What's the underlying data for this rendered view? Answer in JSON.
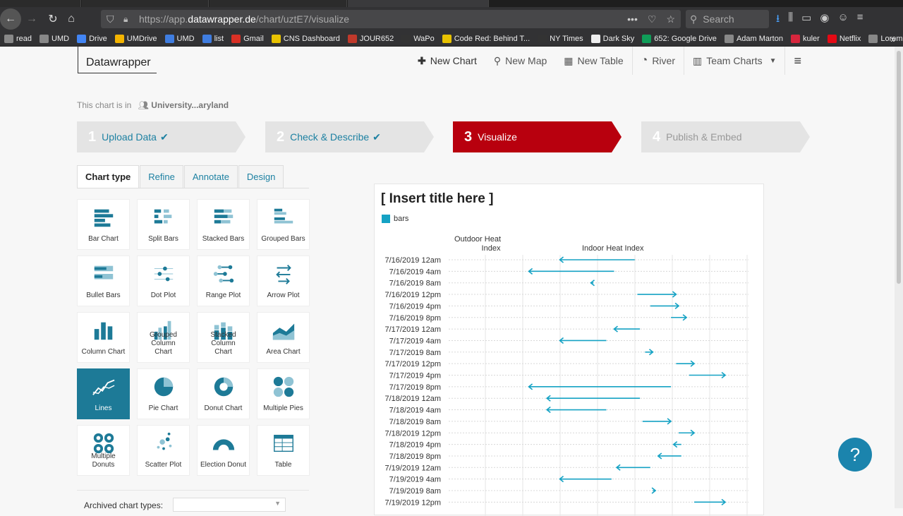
{
  "browser": {
    "url_prefix": "https://app.",
    "url_domain": "datawrapper.de",
    "url_path": "/chart/uztE7/visualize",
    "search_placeholder": "Search",
    "bookmarks": [
      {
        "label": "read",
        "color": "#888"
      },
      {
        "label": "UMD",
        "color": "#888"
      },
      {
        "label": "Drive",
        "color": "#4285f4"
      },
      {
        "label": "UMDrive",
        "color": "#f4b400"
      },
      {
        "label": "UMD",
        "color": "#3f7de0"
      },
      {
        "label": "list",
        "color": "#3f7de0"
      },
      {
        "label": "Gmail",
        "color": "#d93025"
      },
      {
        "label": "CNS Dashboard",
        "color": "#e8c200"
      },
      {
        "label": "JOUR652",
        "color": "#c0392b"
      },
      {
        "label": "WaPo",
        "color": "#333"
      },
      {
        "label": "Code Red: Behind T...",
        "color": "#e8c200"
      },
      {
        "label": "NY Times",
        "color": "#333"
      },
      {
        "label": "Dark Sky",
        "color": "#eee"
      },
      {
        "label": "652: Google Drive",
        "color": "#0f9d58"
      },
      {
        "label": "Adam Marton",
        "color": "#888"
      },
      {
        "label": "kuler",
        "color": "#d7263d"
      },
      {
        "label": "Netflix",
        "color": "#e50914"
      },
      {
        "label": "Lorem",
        "color": "#888"
      }
    ]
  },
  "app": {
    "brand": "Datawrapper",
    "nav": {
      "new_chart": "New Chart",
      "new_map": "New Map",
      "new_table": "New Table",
      "river": "River",
      "team_charts": "Team Charts"
    },
    "breadcrumb_prefix": "This chart is in",
    "breadcrumb_team": "University...aryland",
    "steps": [
      {
        "num": "1",
        "label": "Upload Data",
        "check": "✔"
      },
      {
        "num": "2",
        "label": "Check & Describe",
        "check": "✔"
      },
      {
        "num": "3",
        "label": "Visualize",
        "check": ""
      },
      {
        "num": "4",
        "label": "Publish & Embed",
        "check": ""
      }
    ],
    "tabs": [
      "Chart type",
      "Refine",
      "Annotate",
      "Design"
    ],
    "chart_types": [
      "Bar Chart",
      "Split Bars",
      "Stacked Bars",
      "Grouped Bars",
      "Bullet Bars",
      "Dot Plot",
      "Range Plot",
      "Arrow Plot",
      "Column Chart",
      "Grouped Column Chart",
      "Stacked Column Chart",
      "Area Chart",
      "Lines",
      "Pie Chart",
      "Donut Chart",
      "Multiple Pies",
      "Multiple Donuts",
      "Scatter Plot",
      "Election Donut",
      "Table"
    ],
    "selected_type": "Lines",
    "archived_label": "Archived chart types:",
    "help": "?"
  },
  "chart_data": {
    "type": "arrow",
    "title": "[ Insert title here ]",
    "legend": [
      "bars"
    ],
    "column_labels": [
      "Outdoor Heat Index",
      "Indoor Heat Index"
    ],
    "categories": [
      "7/16/2019 12am",
      "7/16/2019 4am",
      "7/16/2019 8am",
      "7/16/2019 12pm",
      "7/16/2019 4pm",
      "7/16/2019 8pm",
      "7/17/2019 12am",
      "7/17/2019 4am",
      "7/17/2019 8am",
      "7/17/2019 12pm",
      "7/17/2019 4pm",
      "7/17/2019 8pm",
      "7/18/2019 12am",
      "7/18/2019 4am",
      "7/18/2019 8am",
      "7/18/2019 12pm",
      "7/18/2019 4pm",
      "7/18/2019 8pm",
      "7/19/2019 12am",
      "7/19/2019 4am",
      "7/19/2019 8am",
      "7/19/2019 12pm"
    ],
    "from": [
      0.72,
      0.64,
      0.56,
      0.73,
      0.78,
      0.86,
      0.74,
      0.61,
      0.76,
      0.88,
      0.93,
      0.86,
      0.74,
      0.61,
      0.75,
      0.89,
      0.9,
      0.9,
      0.78,
      0.63,
      0.79,
      0.95
    ],
    "to": [
      0.43,
      0.31,
      0.55,
      0.88,
      0.89,
      0.92,
      0.64,
      0.43,
      0.79,
      0.95,
      1.07,
      0.31,
      0.38,
      0.38,
      0.86,
      0.95,
      0.87,
      0.81,
      0.65,
      0.43,
      0.8,
      1.07
    ],
    "color": "#15a2c4",
    "grid": true
  },
  "colors": {
    "accent": "#1d7a97",
    "active_step": "#b8000e",
    "link": "#1d81a2"
  }
}
